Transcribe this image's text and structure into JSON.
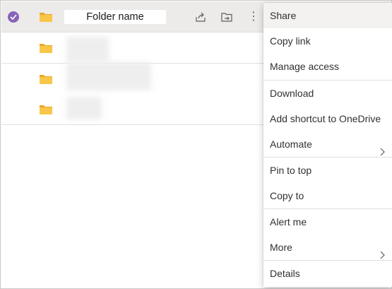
{
  "file_list": {
    "selected_row": {
      "name": "Folder name",
      "selected": true
    }
  },
  "context_menu": {
    "items": [
      {
        "label": "Share"
      },
      {
        "label": "Copy link"
      },
      {
        "label": "Manage access"
      },
      {
        "label": "Download"
      },
      {
        "label": "Add shortcut to OneDrive"
      },
      {
        "label": "Automate",
        "has_submenu": true
      },
      {
        "label": "Pin to top"
      },
      {
        "label": "Copy to"
      },
      {
        "label": "Alert me"
      },
      {
        "label": "More",
        "has_submenu": true
      },
      {
        "label": "Details"
      }
    ]
  },
  "icons": {
    "check": "checkmark-circle-icon",
    "folder": "folder-icon",
    "share": "share-icon",
    "shortcut": "add-shortcut-icon",
    "more": "more-vertical-icon",
    "chevron": "chevron-right-icon"
  },
  "colors": {
    "accent": "#8764b8",
    "folder": "#f8c649",
    "selected_row": "#edebe9"
  }
}
